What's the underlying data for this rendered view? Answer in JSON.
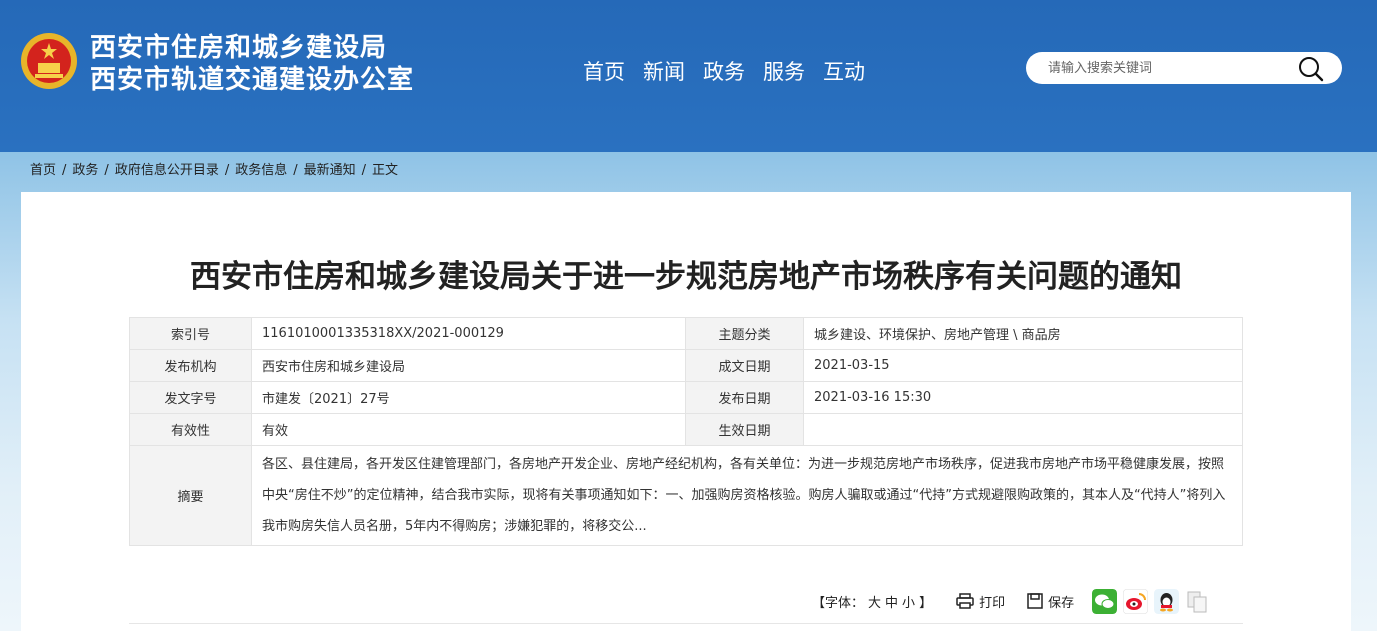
{
  "header": {
    "org_line1": "西安市住房和城乡建设局",
    "org_line2": "西安市轨道交通建设办公室",
    "nav": [
      "首页",
      "新闻",
      "政务",
      "服务",
      "互动"
    ],
    "search_placeholder": "请输入搜索关键词"
  },
  "breadcrumb": [
    "首页",
    "政务",
    "政府信息公开目录",
    "政务信息",
    "最新通知",
    "正文"
  ],
  "breadcrumb_sep": "/",
  "article": {
    "title": "西安市住房和城乡建设局关于进一步规范房地产市场秩序有关问题的通知"
  },
  "meta": {
    "index_label": "索引号",
    "index_value": "1161010001335318XX/2021-000129",
    "topic_label": "主题分类",
    "topic_value": "城乡建设、环境保护、房地产管理 \\ 商品房",
    "issuer_label": "发布机构",
    "issuer_value": "西安市住房和城乡建设局",
    "written_label": "成文日期",
    "written_value": "2021-03-15",
    "docno_label": "发文字号",
    "docno_value": "市建发〔2021〕27号",
    "publish_label": "发布日期",
    "publish_value": "2021-03-16 15:30",
    "valid_label": "有效性",
    "valid_value": "有效",
    "effective_label": "生效日期",
    "effective_value": "",
    "summary_label": "摘要",
    "summary_value": "各区、县住建局，各开发区住建管理部门，各房地产开发企业、房地产经纪机构，各有关单位：为进一步规范房地产市场秩序，促进我市房地产市场平稳健康发展，按照中央“房住不炒”的定位精神，结合我市实际，现将有关事项通知如下：一、加强购房资格核验。购房人骗取或通过“代持”方式规避限购政策的，其本人及“代持人”将列入我市购房失信人员名册，5年内不得购房；涉嫌犯罪的，将移交公..."
  },
  "tools": {
    "font_prefix": "【字体：",
    "font_large": "大",
    "font_medium": "中",
    "font_small": "小",
    "font_suffix": "】",
    "print": "打印",
    "save": "保存"
  },
  "colors": {
    "header_bg": "#2569b8",
    "wechat": "#3cb034",
    "weibo": "#e6162d",
    "qq": "#1e9ee0"
  }
}
